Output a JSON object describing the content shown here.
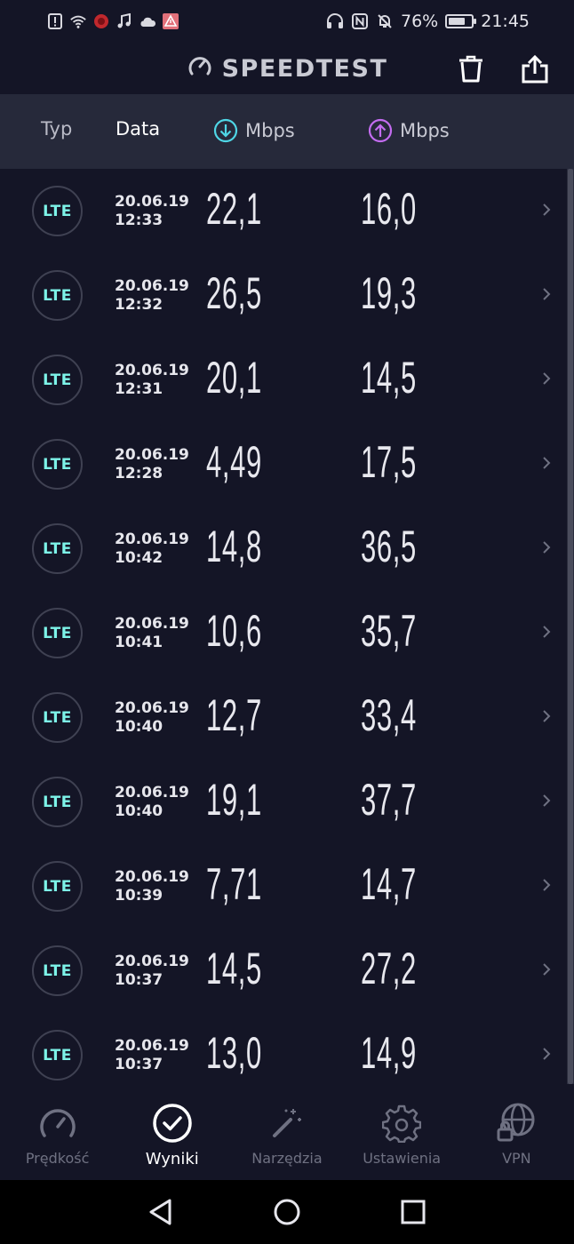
{
  "status_bar": {
    "battery_pct": "76%",
    "battery_level": 0.76,
    "time": "21:45"
  },
  "header": {
    "title": "SPEEDTEST"
  },
  "columns": {
    "type": "Typ",
    "date": "Data",
    "download": "Mbps",
    "upload": "Mbps"
  },
  "results": [
    {
      "type": "LTE",
      "date": "20.06.19",
      "time": "12:33",
      "download": "22,1",
      "upload": "16,0"
    },
    {
      "type": "LTE",
      "date": "20.06.19",
      "time": "12:32",
      "download": "26,5",
      "upload": "19,3"
    },
    {
      "type": "LTE",
      "date": "20.06.19",
      "time": "12:31",
      "download": "20,1",
      "upload": "14,5"
    },
    {
      "type": "LTE",
      "date": "20.06.19",
      "time": "12:28",
      "download": "4,49",
      "upload": "17,5"
    },
    {
      "type": "LTE",
      "date": "20.06.19",
      "time": "10:42",
      "download": "14,8",
      "upload": "36,5"
    },
    {
      "type": "LTE",
      "date": "20.06.19",
      "time": "10:41",
      "download": "10,6",
      "upload": "35,7"
    },
    {
      "type": "LTE",
      "date": "20.06.19",
      "time": "10:40",
      "download": "12,7",
      "upload": "33,4"
    },
    {
      "type": "LTE",
      "date": "20.06.19",
      "time": "10:40",
      "download": "19,1",
      "upload": "37,7"
    },
    {
      "type": "LTE",
      "date": "20.06.19",
      "time": "10:39",
      "download": "7,71",
      "upload": "14,7"
    },
    {
      "type": "LTE",
      "date": "20.06.19",
      "time": "10:37",
      "download": "14,5",
      "upload": "27,2"
    },
    {
      "type": "LTE",
      "date": "20.06.19",
      "time": "10:37",
      "download": "13,0",
      "upload": "14,9"
    }
  ],
  "nav": {
    "speed": "Prędkość",
    "results": "Wyniki",
    "tools": "Narzędzia",
    "settings": "Ustawienia",
    "vpn": "VPN"
  },
  "colors": {
    "background": "#141526",
    "header_band": "#26293a",
    "accent_download": "#4fd6e6",
    "accent_upload": "#c36cf0",
    "lte_badge": "#7df3e8"
  }
}
